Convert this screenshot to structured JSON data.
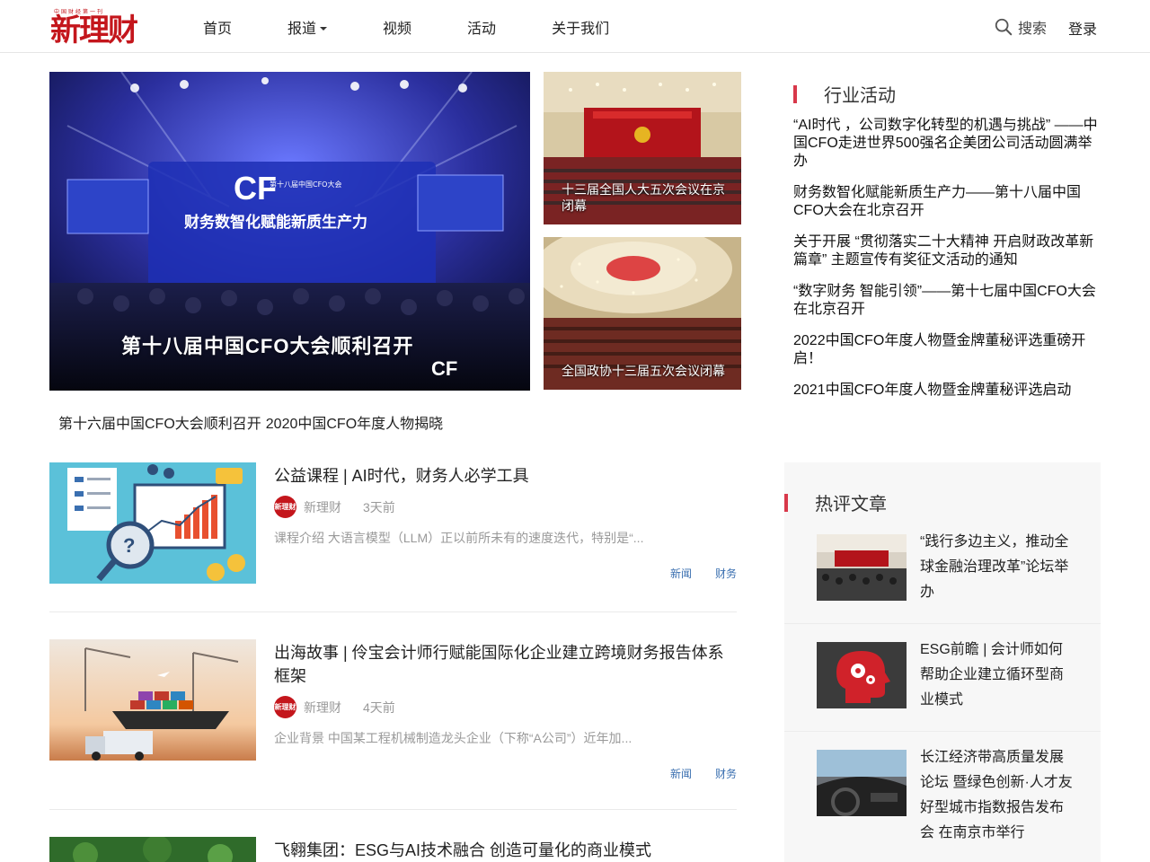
{
  "header": {
    "logo_text": "新理财",
    "logo_tagline": "中国财经第一刊",
    "nav": [
      {
        "label": "首页"
      },
      {
        "label": "报道"
      },
      {
        "label": "视频"
      },
      {
        "label": "活动"
      },
      {
        "label": "关于我们"
      }
    ],
    "search_label": "搜索",
    "login_label": "登录"
  },
  "carousel": {
    "main_caption": "第十八届中国CFO大会顺利召开",
    "main_banner_title": "财务数智化赋能新质生产力",
    "side": [
      {
        "caption": "十三届全国人大五次会议在京闭幕"
      },
      {
        "caption": "全国政协十三届五次会议闭幕"
      }
    ],
    "links": [
      {
        "text": "第十六届中国CFO大会顺利召开"
      },
      {
        "text": "2020中国CFO年度人物揭晓"
      }
    ]
  },
  "articles": [
    {
      "title": "公益课程 | AI时代，财务人必学工具",
      "author": "新理财",
      "time": "3天前",
      "excerpt": "课程介绍 大语言模型（LLM）正以前所未有的速度迭代，特别是“...",
      "tags": [
        "新闻",
        "财务"
      ]
    },
    {
      "title": "出海故事 | 伶宝会计师行赋能国际化企业建立跨境财务报告体系框架",
      "author": "新理财",
      "time": "4天前",
      "excerpt": "企业背景 中国某工程机械制造龙头企业（下称“A公司”）近年加...",
      "tags": [
        "新闻",
        "财务"
      ]
    },
    {
      "title": "飞翱集团：ESG与AI技术融合 创造可量化的商业模式"
    }
  ],
  "industry_events": {
    "heading": "行业活动",
    "items": [
      "“AI时代 ，公司数字化转型的机遇与挑战” ——中国CFO走进世界500强名企美团公司活动圆满举办",
      "财务数智化赋能新质生产力——第十八届中国CFO大会在北京召开",
      "关于开展 “贯彻落实二十大精神 开启财政改革新篇章” 主题宣传有奖征文活动的通知",
      "“数字财务 智能引领”——第十七届中国CFO大会在北京召开",
      "2022中国CFO年度人物暨金牌董秘评选重磅开启！",
      "2021中国CFO年度人物暨金牌董秘评选启动"
    ]
  },
  "hot_articles": {
    "heading": "热评文章",
    "items": [
      "“践行多边主义，推动全球金融治理改革”论坛举办",
      "ESG前瞻 | 会计师如何帮助企业建立循环型商业模式",
      "长江经济带高质量发展论坛 暨绿色创新·人才友好型城市指数报告发布会 在南京市举行"
    ]
  },
  "colors": {
    "brand_red": "#c4161c",
    "accent_bar": "#d8384a",
    "tag_blue": "#3a6fb0"
  }
}
